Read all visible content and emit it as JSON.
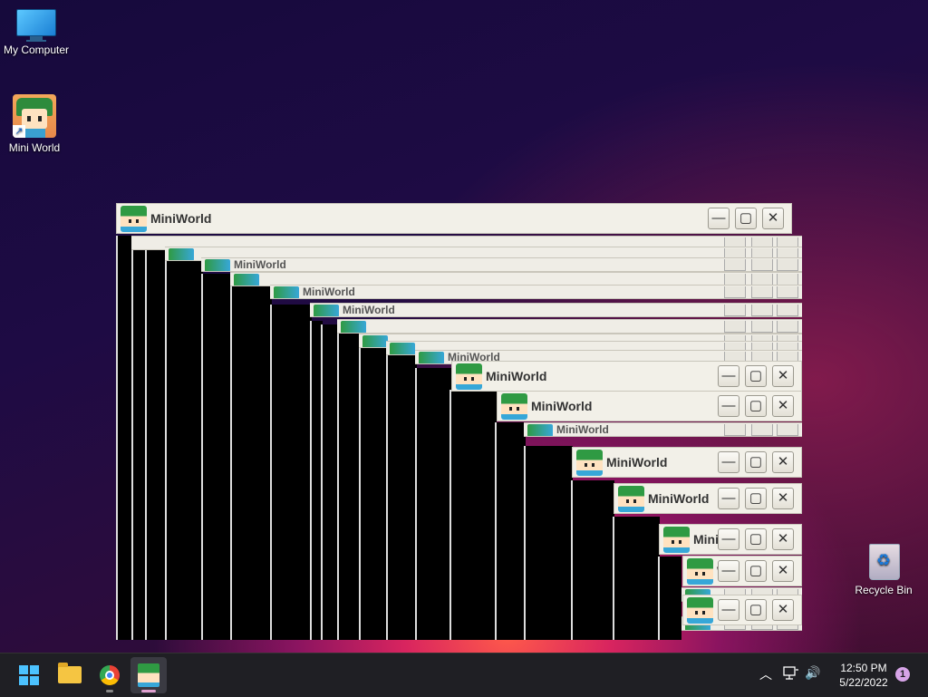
{
  "desktop": {
    "icons": [
      {
        "label": "My Computer"
      },
      {
        "label": "Mini World"
      },
      {
        "label": "Recycle Bin"
      }
    ]
  },
  "windows": {
    "title": "MiniWorld",
    "btn_minimize": "—",
    "btn_maximize": "▢",
    "btn_close": "✕",
    "partial_title_1": "Mini",
    "partial_title_2": "Wo"
  },
  "taskbar": {
    "apps": [
      "start-menu",
      "file-explorer",
      "chrome",
      "mini-world"
    ],
    "tray": {
      "chevron": "︿",
      "network_icon": "network-icon",
      "volume": "🔊"
    },
    "clock": {
      "time": "12:50 PM",
      "date": "5/22/2022"
    },
    "notification_count": "1"
  }
}
